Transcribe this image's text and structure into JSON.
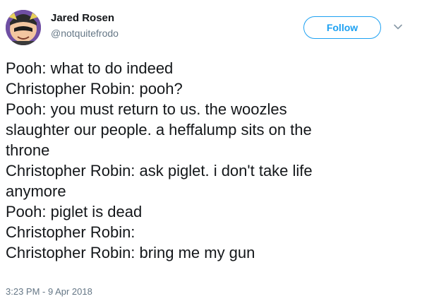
{
  "user": {
    "display_name": "Jared Rosen",
    "handle": "@notquitefrodo"
  },
  "header": {
    "follow_label": "Follow",
    "menu_icon": "chevron-down-icon"
  },
  "tweet": {
    "lines": [
      "Pooh: what to do indeed",
      "Christopher Robin: pooh?",
      "Pooh: you must return to us. the woozles",
      "slaughter our people. a heffalump sits on the",
      "throne",
      "Christopher Robin: ask piglet. i don't take life",
      "anymore",
      "Pooh: piglet is dead",
      "Christopher Robin:",
      "Christopher Robin: bring me my gun"
    ],
    "timestamp": "3:23 PM - 9 Apr 2018"
  },
  "colors": {
    "accent": "#1da1f2",
    "text": "#14171a",
    "muted": "#657786"
  }
}
